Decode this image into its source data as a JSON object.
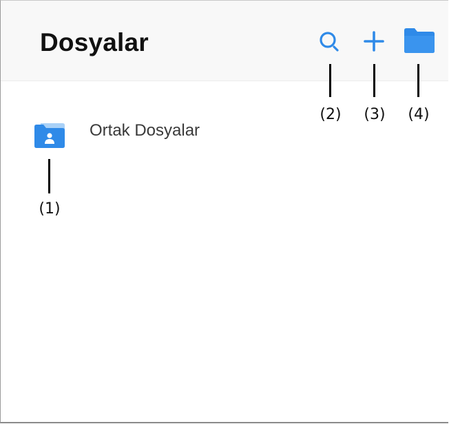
{
  "header": {
    "title": "Dosyalar"
  },
  "toolbar": {
    "icons": [
      "search-icon",
      "plus-icon",
      "folder-icon"
    ]
  },
  "files": {
    "items": [
      {
        "label": "Ortak Dosyalar",
        "icon": "shared-folder-icon"
      }
    ]
  },
  "callouts": [
    "(1)",
    "(2)",
    "(3)",
    "(4)"
  ],
  "colors": {
    "accent": "#2f8ae8",
    "header_bg": "#f8f8f8",
    "folder_light": "#a9d1f7"
  }
}
